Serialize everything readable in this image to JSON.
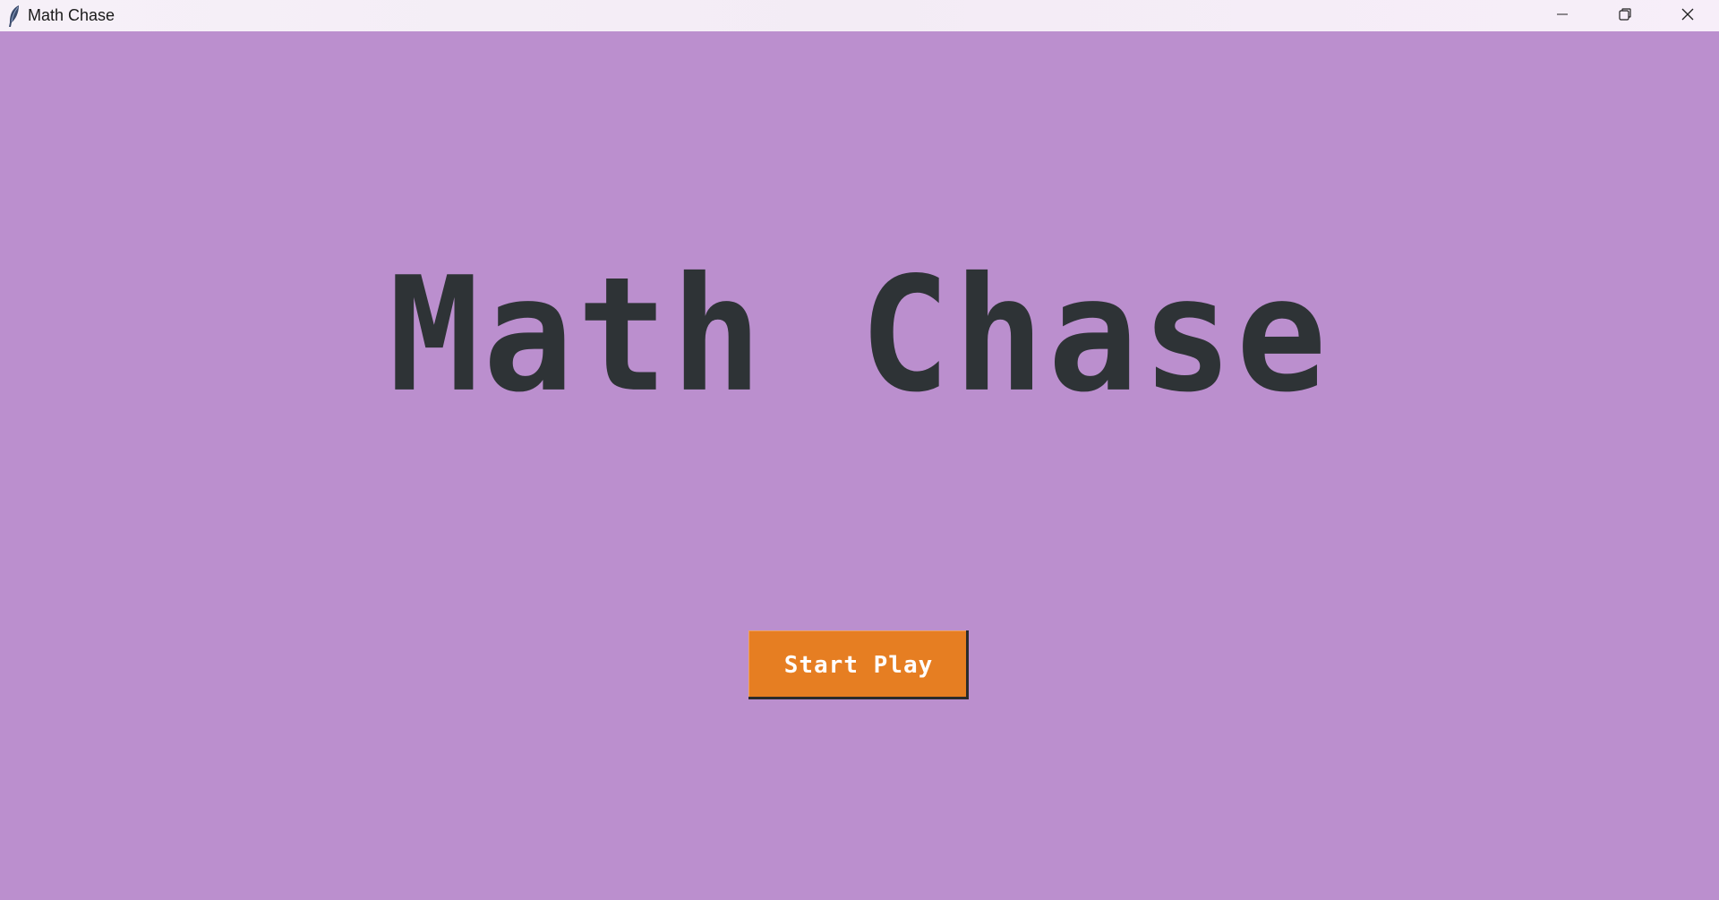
{
  "window": {
    "title": "Math Chase",
    "icon": "feather-icon",
    "controls": [
      "minimize-icon",
      "restore-icon",
      "close-icon"
    ]
  },
  "main": {
    "title": "Math Chase",
    "start_button_label": "Start Play"
  },
  "colors": {
    "background": "#bb8fce",
    "title_text": "#2e3336",
    "button_bg": "#e67e22",
    "button_text": "#ffffff"
  }
}
